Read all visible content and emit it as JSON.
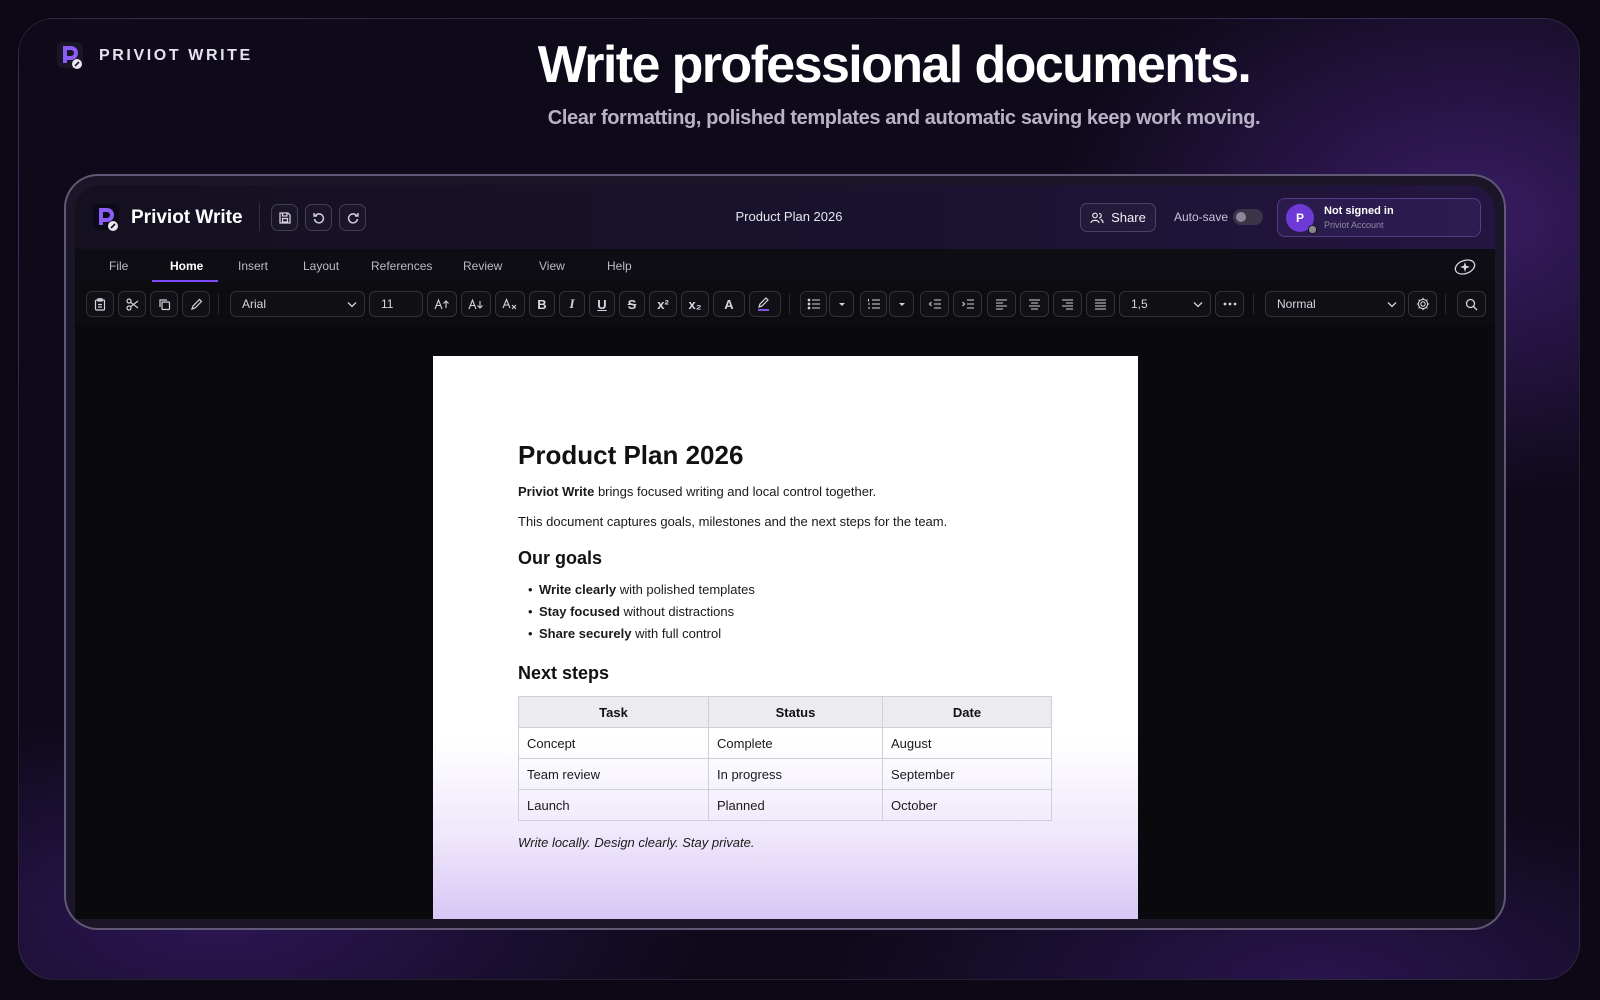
{
  "brand": {
    "name": "PRIVIOT WRITE"
  },
  "hero": {
    "title": "Write professional documents.",
    "subtitle": "Clear formatting, polished templates and automatic saving keep work moving."
  },
  "app": {
    "name": "Priviot Write",
    "document_title": "Product Plan 2026",
    "share_label": "Share",
    "autosave_label": "Auto-save",
    "autosave_on": false,
    "account": {
      "initial": "P",
      "status": "Not signed in",
      "subtitle": "Priviot Account"
    }
  },
  "menu": {
    "tabs": [
      {
        "label": "File"
      },
      {
        "label": "Home",
        "active": true
      },
      {
        "label": "Insert"
      },
      {
        "label": "Layout"
      },
      {
        "label": "References"
      },
      {
        "label": "Review"
      },
      {
        "label": "View"
      },
      {
        "label": "Help"
      }
    ]
  },
  "ribbon": {
    "font_family": "Arial",
    "font_size": "11",
    "bold": "B",
    "italic": "I",
    "underline": "U",
    "strike": "S",
    "superscript": "x²",
    "subscript": "x₂",
    "font_color": "A",
    "line_spacing": "1,5",
    "style": "Normal"
  },
  "document": {
    "title": "Product Plan 2026",
    "intro_bold": "Priviot Write",
    "intro_rest": " brings focused writing and local control together.",
    "para2": "This document captures goals, milestones and the next steps for the team.",
    "goals_heading": "Our goals",
    "goals": [
      {
        "bold": "Write clearly",
        "rest": " with polished templates"
      },
      {
        "bold": "Stay focused",
        "rest": " without distractions"
      },
      {
        "bold": "Share securely",
        "rest": " with full control"
      }
    ],
    "steps_heading": "Next steps",
    "table": {
      "headers": [
        "Task",
        "Status",
        "Date"
      ],
      "rows": [
        [
          "Concept",
          "Complete",
          "August"
        ],
        [
          "Team review",
          "In progress",
          "September"
        ],
        [
          "Launch",
          "Planned",
          "October"
        ]
      ]
    },
    "closing": "Write locally. Design clearly. Stay private."
  },
  "colors": {
    "accent": "#7c4dff",
    "avatar": "#6d3ad6"
  }
}
